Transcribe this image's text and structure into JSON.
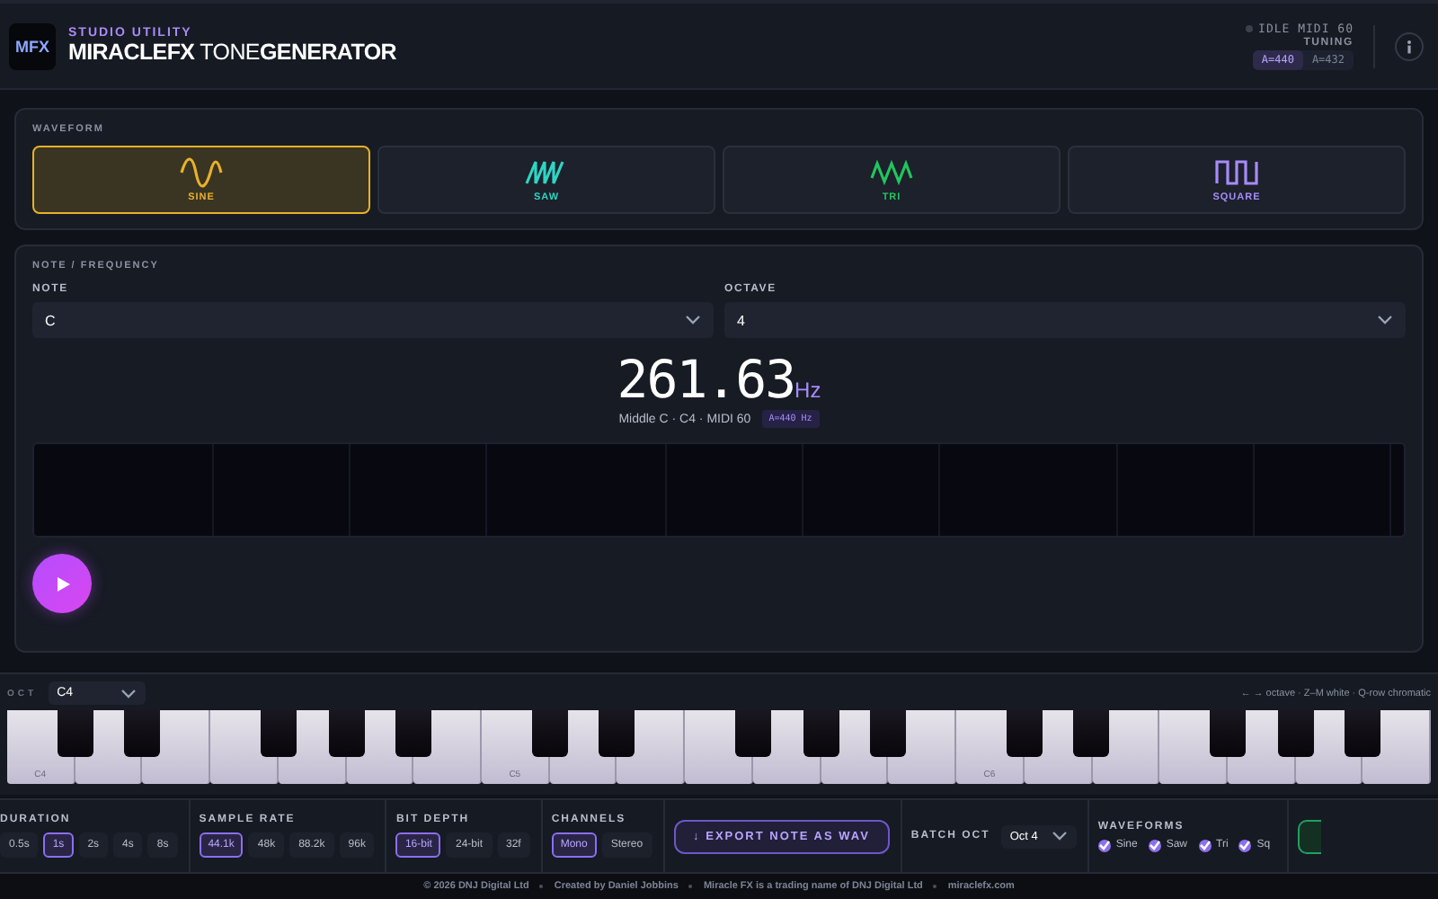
{
  "header": {
    "logo": "MFX",
    "kicker": "STUDIO UTILITY",
    "title_bold": "MIRACLEFX",
    "title_light": "TONE",
    "title_end": "GENERATOR",
    "status": "IDLE MIDI 60",
    "tuning_label": "TUNING",
    "tuning": [
      {
        "label": "A=440",
        "selected": true
      },
      {
        "label": "A=432",
        "selected": false
      }
    ]
  },
  "waveform": {
    "title": "WAVEFORM",
    "options": [
      {
        "kind": "sine",
        "label": "SINE",
        "color": "#e8b12a",
        "selected": true
      },
      {
        "kind": "saw",
        "label": "SAW",
        "color": "#2fd4c4",
        "selected": false
      },
      {
        "kind": "tri",
        "label": "TRI",
        "color": "#22c55e",
        "selected": false
      },
      {
        "kind": "square",
        "label": "SQUARE",
        "color": "#a78bfa",
        "selected": false
      }
    ]
  },
  "note": {
    "title": "NOTE / FREQUENCY",
    "fields": [
      {
        "label": "NOTE",
        "value": "C"
      },
      {
        "label": "OCTAVE",
        "value": "4"
      }
    ],
    "frequency": "261.63",
    "unit": "Hz",
    "detail": "Middle C · C4 · MIDI 60",
    "badge": "A=440 Hz"
  },
  "keyboard": {
    "oct_label": "OCT",
    "oct_value": "C4",
    "hints": "← → octave · Z–M white · Q-row chromatic",
    "octaves": [
      {
        "label": "C4"
      },
      {
        "label": "C5"
      },
      {
        "label": "C6"
      }
    ]
  },
  "export": {
    "groups": [
      {
        "title": "DURATION",
        "options": [
          {
            "label": "0.5s",
            "selected": false
          },
          {
            "label": "1s",
            "selected": true
          },
          {
            "label": "2s",
            "selected": false
          },
          {
            "label": "4s",
            "selected": false
          },
          {
            "label": "8s",
            "selected": false
          }
        ]
      },
      {
        "title": "SAMPLE RATE",
        "options": [
          {
            "label": "44.1k",
            "selected": true
          },
          {
            "label": "48k",
            "selected": false
          },
          {
            "label": "88.2k",
            "selected": false
          },
          {
            "label": "96k",
            "selected": false
          }
        ]
      },
      {
        "title": "BIT DEPTH",
        "options": [
          {
            "label": "16-bit",
            "selected": true
          },
          {
            "label": "24-bit",
            "selected": false
          },
          {
            "label": "32f",
            "selected": false
          }
        ]
      },
      {
        "title": "CHANNELS",
        "options": [
          {
            "label": "Mono",
            "selected": true
          },
          {
            "label": "Stereo",
            "selected": false
          }
        ]
      }
    ],
    "button": "↓ EXPORT NOTE AS WAV",
    "batch_label": "BATCH OCT",
    "batch_value": "Oct 4",
    "waveforms_title": "WAVEFORMS",
    "waveforms": [
      {
        "label": "Sine",
        "checked": true
      },
      {
        "label": "Saw",
        "checked": true
      },
      {
        "label": "Tri",
        "checked": true
      },
      {
        "label": "Sq",
        "checked": true
      }
    ]
  },
  "footer": [
    "© 2026 DNJ Digital Ltd",
    "Created by Daniel Jobbins",
    "Miracle FX is a trading name of DNJ Digital Ltd",
    "miraclefx.com"
  ]
}
